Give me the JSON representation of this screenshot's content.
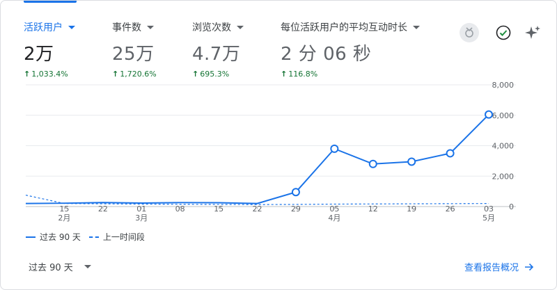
{
  "metrics": [
    {
      "label": "活跃用户",
      "value": "2万",
      "delta": "1,033.4%"
    },
    {
      "label": "事件数",
      "value": "25万",
      "delta": "1,720.6%"
    },
    {
      "label": "浏览次数",
      "value": "4.7万",
      "delta": "695.3%"
    },
    {
      "label": "每位活跃用户的平均互动时长",
      "value": "2 分 06 秒",
      "delta": "116.8%"
    }
  ],
  "icons": [
    "badge-icon",
    "check-circle-icon",
    "sparkle-icon"
  ],
  "legend": {
    "current": "过去 90 天",
    "previous": "上一时间段"
  },
  "footer": {
    "range": "过去 90 天",
    "link": "查看报告概况"
  },
  "colors": {
    "accent": "#1a73e8",
    "positive": "#137333",
    "grid": "#e8eaed"
  },
  "chart_data": {
    "type": "line",
    "x_ticks": [
      "15",
      "22",
      "01",
      "08",
      "15",
      "22",
      "29",
      "05",
      "12",
      "19",
      "26",
      "03"
    ],
    "month_labels": [
      {
        "tick": "15",
        "month": "2月"
      },
      {
        "tick": "01",
        "month": "3月"
      },
      {
        "tick": "05",
        "month": "4月"
      },
      {
        "tick": "03",
        "month": "5月"
      }
    ],
    "y_ticks": [
      "8,000",
      "6,000",
      "4,000",
      "2,000",
      "0"
    ],
    "ylim": [
      0,
      8000
    ],
    "grid": true,
    "series": [
      {
        "name": "过去 90 天",
        "style": "solid",
        "values": [
          200,
          220,
          260,
          230,
          260,
          250,
          200,
          950,
          3800,
          2800,
          2950,
          3500,
          6050
        ],
        "markers": [
          false,
          false,
          false,
          false,
          false,
          false,
          false,
          true,
          true,
          true,
          true,
          true,
          true
        ]
      },
      {
        "name": "上一时间段",
        "style": "dashed",
        "values": [
          750,
          200,
          180,
          160,
          150,
          140,
          130,
          140,
          160,
          170,
          180,
          190,
          200
        ],
        "markers": [
          false,
          false,
          false,
          false,
          false,
          false,
          false,
          false,
          false,
          false,
          false,
          false,
          false
        ]
      }
    ]
  }
}
